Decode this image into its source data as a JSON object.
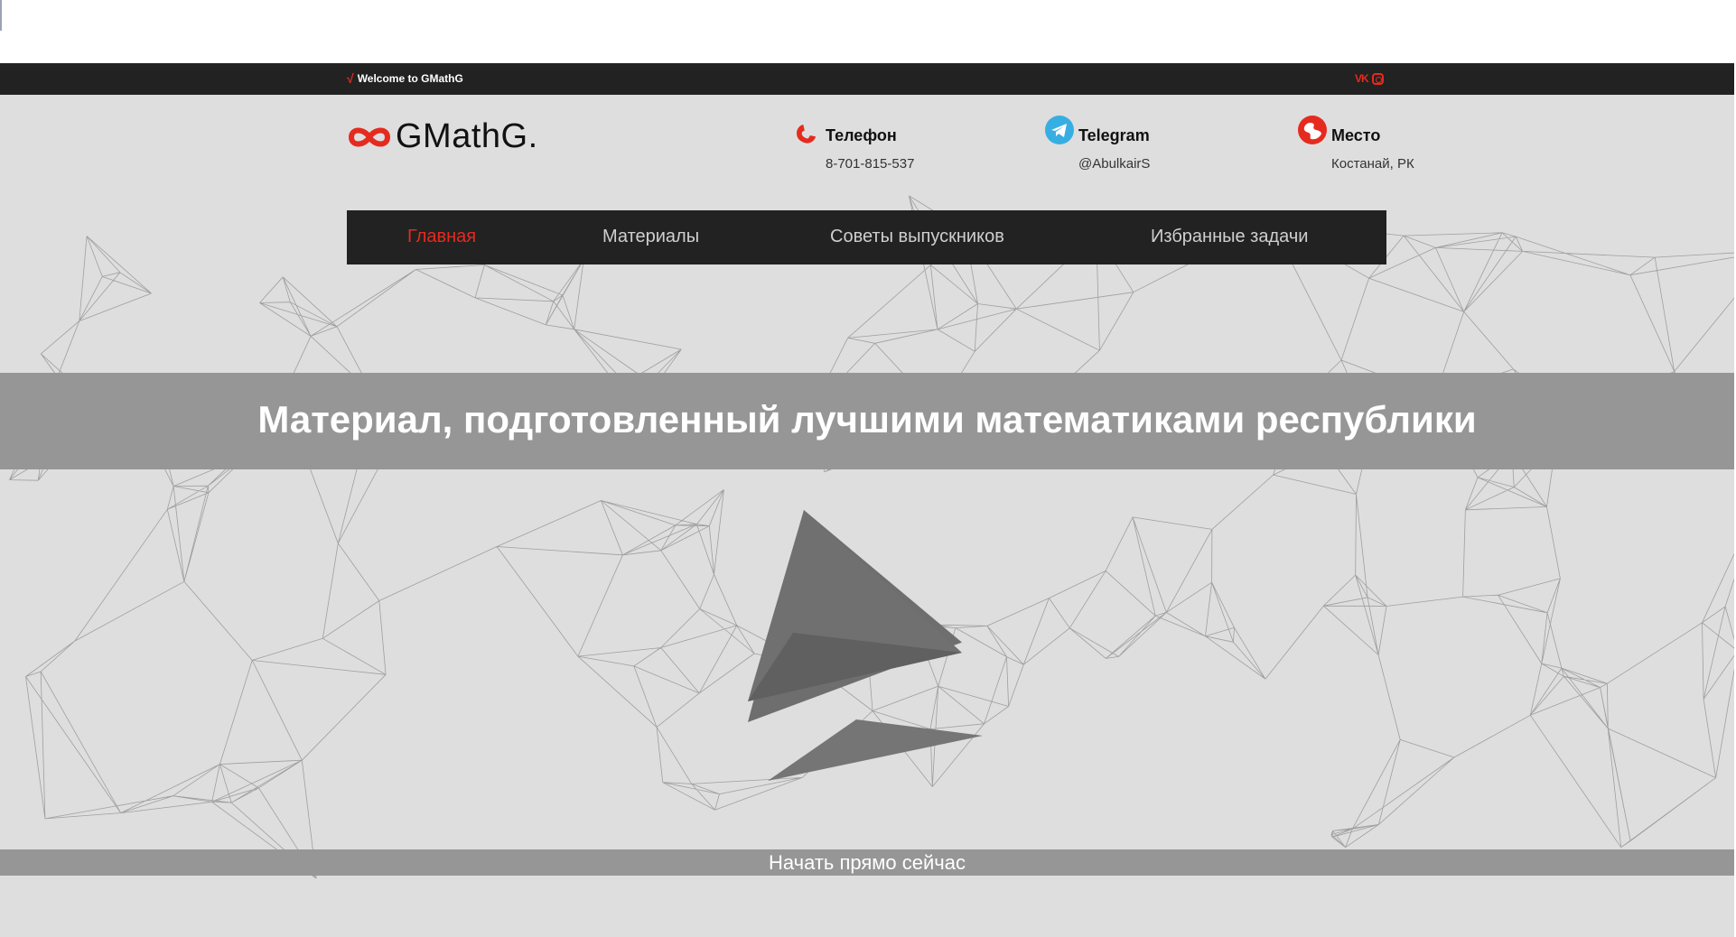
{
  "topbar": {
    "welcome_text": "Welcome to GMathG",
    "welcome_icon": "square-root-icon",
    "social_icons": [
      "vk-icon",
      "instagram-icon"
    ]
  },
  "header": {
    "logo_text": "GMathG.",
    "logo_icon": "infinity-icon",
    "contacts": [
      {
        "title": "Телефон",
        "value": "8-701-815-537",
        "icon": "phone-icon"
      },
      {
        "title": "Telegram",
        "value": "@AbulkairS",
        "icon": "telegram-icon"
      },
      {
        "title": "Место",
        "value": "Костанай, РК",
        "icon": "location-icon"
      }
    ]
  },
  "nav": {
    "items": [
      {
        "label": "Главная",
        "active": true
      },
      {
        "label": "Материалы",
        "active": false
      },
      {
        "label": "Советы выпускников",
        "active": false
      },
      {
        "label": "Избранные задачи",
        "active": false
      }
    ]
  },
  "hero": {
    "title": "Материал, подготовленный лучшими математиками республики",
    "cta_label": "Начать прямо сейчас"
  },
  "colors": {
    "accent": "#e52b1f",
    "dark": "#222222",
    "background": "#dedede",
    "banner": "#969696"
  }
}
